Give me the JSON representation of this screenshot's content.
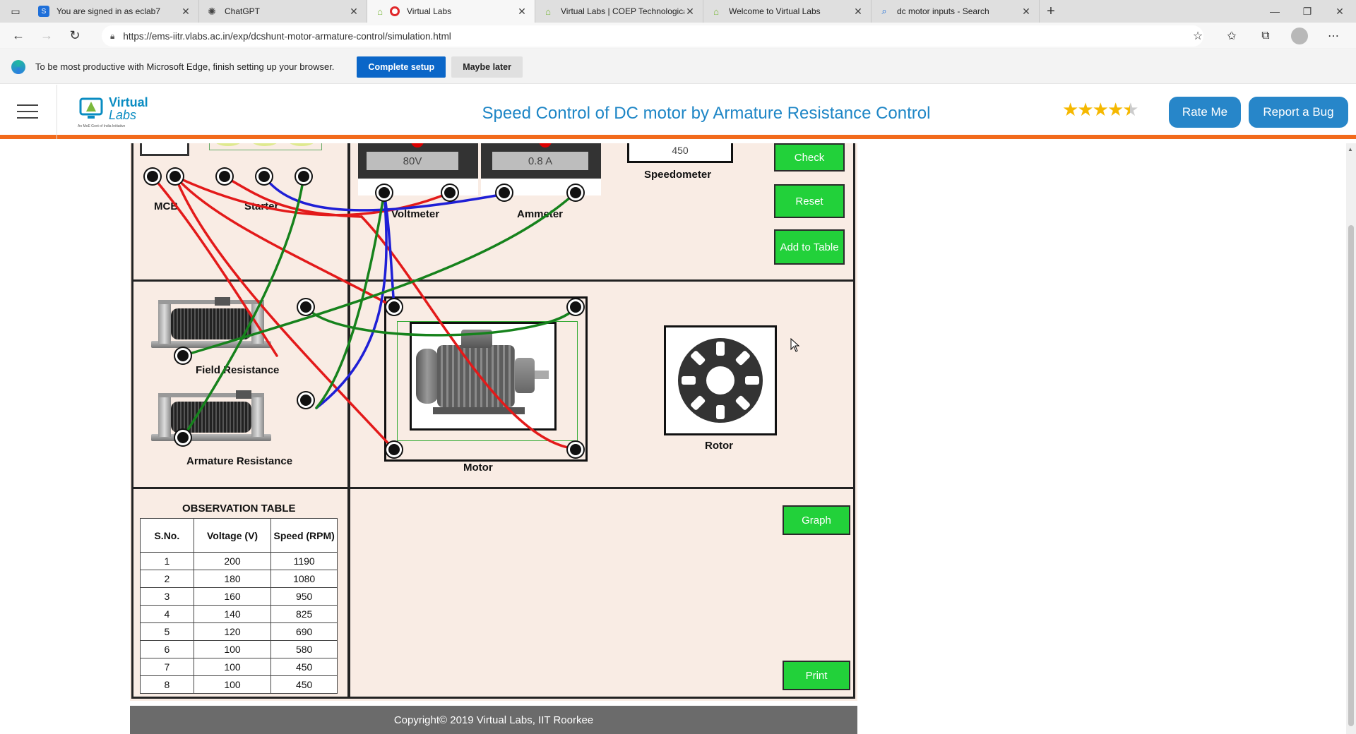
{
  "browser": {
    "tabs": [
      {
        "title": "You are signed in as eclab7",
        "icon": "s-icon",
        "color": "#1e6fd9"
      },
      {
        "title": "ChatGPT",
        "icon": "chatgpt-icon",
        "color": "#444444"
      },
      {
        "title": "Virtual Labs",
        "icon": "record-icon",
        "color": "#e0282b",
        "active": true
      },
      {
        "title": "Virtual Labs | COEP Technologica",
        "icon": "vlabs-icon",
        "color": "#7bb83c"
      },
      {
        "title": "Welcome to Virtual Labs",
        "icon": "vlabs-icon",
        "color": "#7bb83c"
      },
      {
        "title": "dc motor inputs - Search",
        "icon": "search-icon",
        "color": "#1e6fd9"
      }
    ],
    "url": "https://ems-iitr.vlabs.ac.in/exp/dcshunt-motor-armature-control/simulation.html"
  },
  "infobar": {
    "text": "To be most productive with Microsoft Edge, finish setting up your browser.",
    "primary_button": "Complete setup",
    "secondary_button": "Maybe later"
  },
  "header": {
    "logo_line1": "Virtual",
    "logo_line2": "Labs",
    "logo_tagline": "An MoE Govt of India Initiative",
    "title": "Speed Control of DC motor by Armature Resistance Control",
    "rating": 4.5,
    "rate_button": "Rate Me",
    "bug_button": "Report a Bug"
  },
  "simulation": {
    "labels": {
      "mcb": "MCB",
      "starter": "Starter",
      "voltmeter": "Voltmeter",
      "ammeter": "Ammeter",
      "speedometer": "Speedometer",
      "field_resistance": "Field Resistance",
      "armature_resistance": "Armature Resistance",
      "motor": "Motor",
      "rotor": "Rotor"
    },
    "readings": {
      "voltmeter": "80V",
      "ammeter": "0.8 A",
      "speedometer": "450"
    },
    "buttons": {
      "check": "Check",
      "reset": "Reset",
      "add_to_table": "Add to Table",
      "graph": "Graph",
      "print": "Print"
    },
    "wire_colors": {
      "red": "#e31a1a",
      "blue": "#1f1fd6",
      "green": "#16821c"
    },
    "observation_table": {
      "title": "OBSERVATION TABLE",
      "headers": [
        "S.No.",
        "Voltage (V)",
        "Speed (RPM)"
      ],
      "rows": [
        [
          "1",
          "200",
          "1190"
        ],
        [
          "2",
          "180",
          "1080"
        ],
        [
          "3",
          "160",
          "950"
        ],
        [
          "4",
          "140",
          "825"
        ],
        [
          "5",
          "120",
          "690"
        ],
        [
          "6",
          "100",
          "580"
        ],
        [
          "7",
          "100",
          "450"
        ],
        [
          "8",
          "100",
          "450"
        ]
      ]
    }
  },
  "footer": {
    "text": "Copyright© 2019 Virtual Labs, IIT Roorkee"
  }
}
